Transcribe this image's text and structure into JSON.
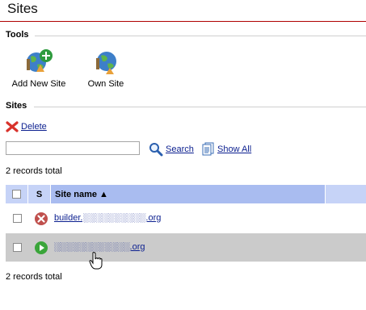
{
  "page": {
    "title": "Sites"
  },
  "tools": {
    "heading": "Tools",
    "items": [
      {
        "label": "Add New Site",
        "icon": "globe-add-icon"
      },
      {
        "label": "Own Site",
        "icon": "globe-own-icon"
      }
    ]
  },
  "sites": {
    "heading": "Sites",
    "delete_label": "Delete",
    "search": {
      "value": "",
      "placeholder": "",
      "button_label": "Search"
    },
    "show_all_label": "Show All",
    "records_total_top": "2  records total",
    "records_total_bottom": "2  records total",
    "grid": {
      "headers": {
        "status": "S",
        "site_name": "Site name ▲"
      },
      "rows": [
        {
          "status_icon": "disabled-x-icon",
          "status_color": "#c0504d",
          "site_name": "builder.░░░░░░░░░░.org"
        },
        {
          "status_icon": "running-play-icon",
          "status_color": "#3aa53a",
          "site_name": "░░░░░░░░░░░░.org",
          "selected": true
        }
      ]
    }
  },
  "colors": {
    "accent_line": "#b00000",
    "link": "#0b1f8f",
    "grid_header": "#c6d3f7",
    "grid_header_sorted": "#a9bcf0",
    "row_selected": "#cbcbcb"
  }
}
